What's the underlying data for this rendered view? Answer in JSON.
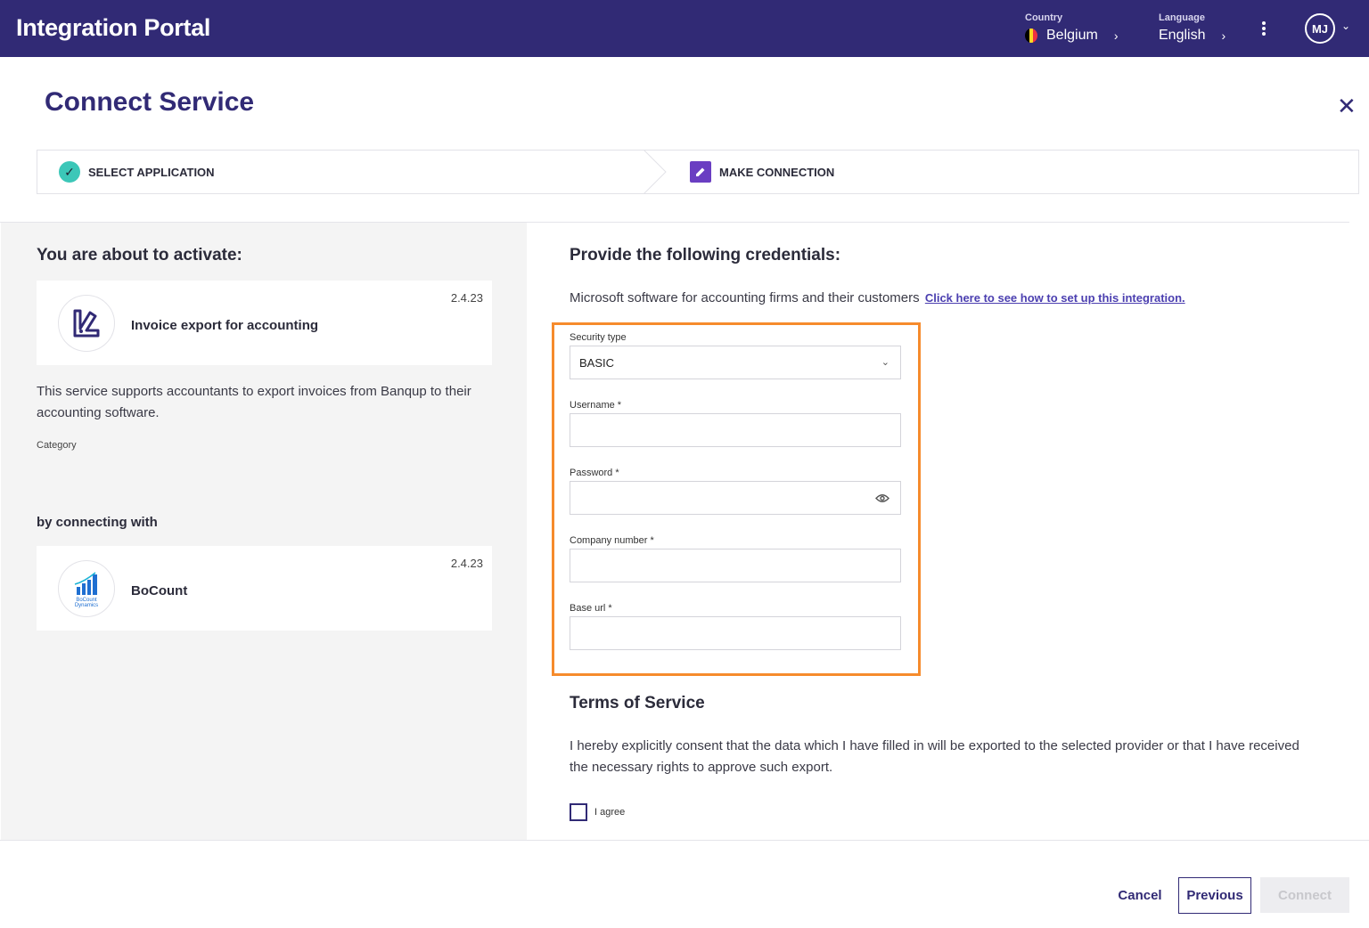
{
  "topbar": {
    "title": "Integration Portal",
    "country_label": "Country",
    "country_value": "Belgium",
    "language_label": "Language",
    "language_value": "English",
    "avatar_initials": "MJ"
  },
  "header": {
    "title": "Connect Service"
  },
  "stepper": {
    "steps": [
      {
        "label": "SELECT APPLICATION",
        "status": "completed"
      },
      {
        "label": "MAKE CONNECTION",
        "status": "active"
      }
    ]
  },
  "left": {
    "about_title": "You are about to activate:",
    "service": {
      "name": "Invoice export for accounting",
      "version": "2.4.23"
    },
    "description": "This service supports accountants to export invoices from Banqup to their accounting software.",
    "category_label": "Category",
    "by_connecting": "by connecting with",
    "provider": {
      "name": "BoCount",
      "version": "2.4.23",
      "logo_text_1": "BoCount",
      "logo_text_2": "Dynamics"
    }
  },
  "right": {
    "title": "Provide the following credentials:",
    "description": "Microsoft software for accounting firms and their customers",
    "help_link": "Click here to see how to set up this integration.",
    "fields": {
      "security_type": {
        "label": "Security type",
        "value": "BASIC"
      },
      "username": {
        "label": "Username *",
        "value": ""
      },
      "password": {
        "label": "Password *",
        "value": ""
      },
      "company_number": {
        "label": "Company number *",
        "value": ""
      },
      "base_url": {
        "label": "Base url *",
        "value": ""
      }
    },
    "tos_title": "Terms of Service",
    "tos_text": "I hereby explicitly consent that the data which I have filled in will be exported to the selected provider or that I have received the necessary rights to approve such export.",
    "agree_label": "I agree"
  },
  "footer": {
    "cancel": "Cancel",
    "previous": "Previous",
    "connect": "Connect"
  },
  "colors": {
    "brand": "#312a75",
    "highlight": "#f68b2c",
    "success": "#3cc7b8",
    "active_step": "#6a3ec2"
  }
}
